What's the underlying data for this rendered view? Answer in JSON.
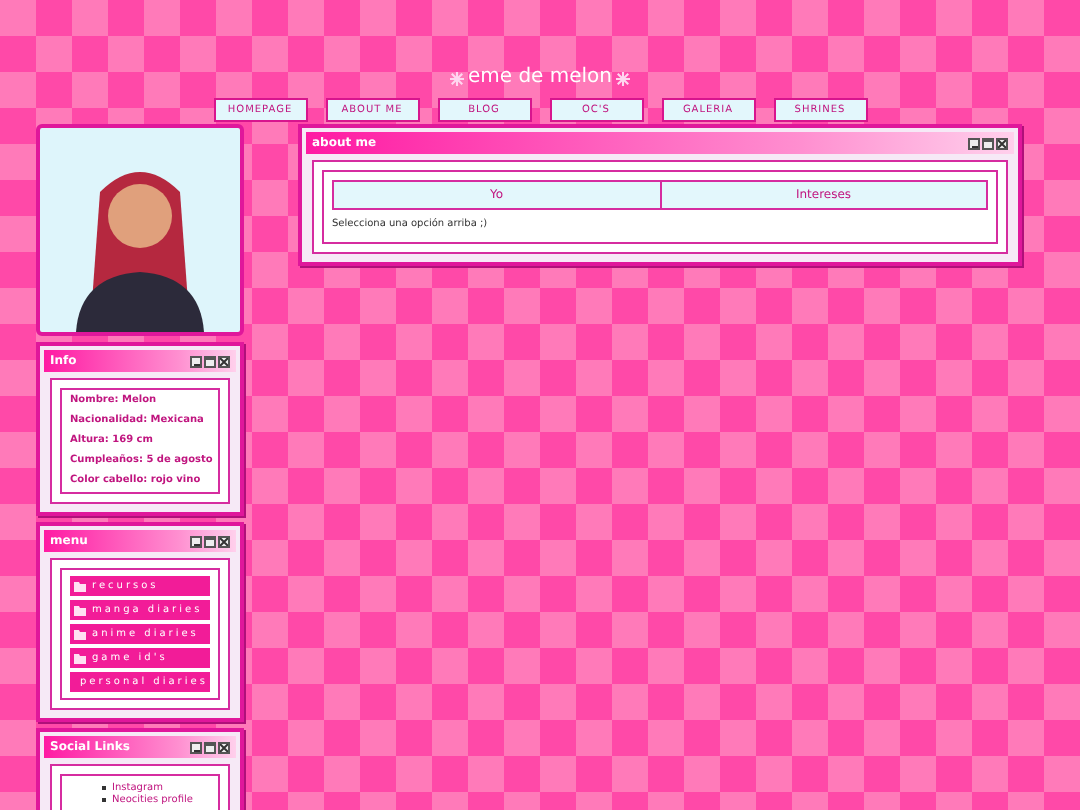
{
  "site_title": "eme de melon",
  "nav": [
    {
      "label": "HOMEPAGE"
    },
    {
      "label": "ABOUT ME"
    },
    {
      "label": "BLOG"
    },
    {
      "label": "OC'S"
    },
    {
      "label": "GALERIA"
    },
    {
      "label": "SHRINES"
    }
  ],
  "info": {
    "title": "Info",
    "lines": [
      "Nombre: Melon",
      "Nacionalidad: Mexicana",
      "Altura: 169 cm",
      "Cumpleaños: 5 de agosto",
      "Color cabello: rojo vino"
    ]
  },
  "menu": {
    "title": "menu",
    "items": [
      "recursos",
      "manga diaries",
      "anime diaries",
      "game id's",
      "personal diaries"
    ]
  },
  "social": {
    "title": "Social Links",
    "links": [
      "Instagram",
      "Neocities profile"
    ]
  },
  "about": {
    "title": "about me",
    "tabs": [
      {
        "label": "Yo",
        "selected": false
      },
      {
        "label": "Intereses",
        "selected": false
      }
    ],
    "message": "Selecciona una opción arriba ;)"
  }
}
